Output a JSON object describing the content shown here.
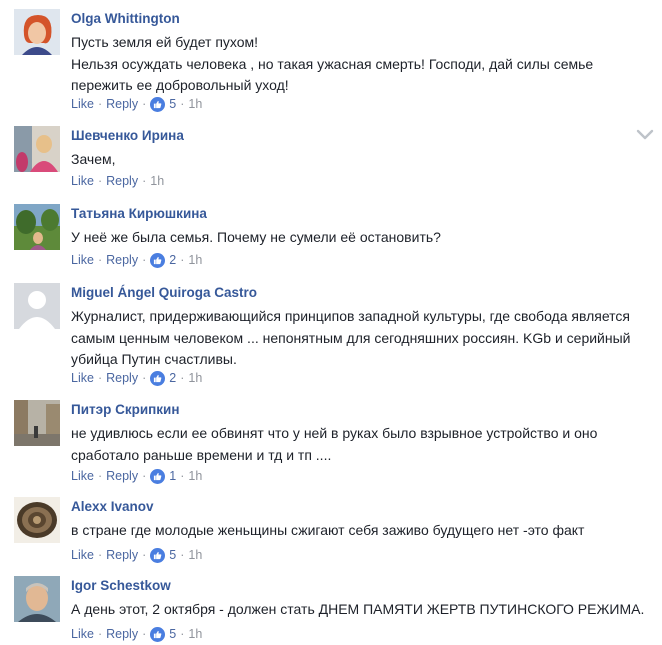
{
  "actions": {
    "like": "Like",
    "reply": "Reply",
    "separator": "·"
  },
  "comments": [
    {
      "author": "Olga Whittington",
      "lines": [
        "Пусть земля ей будет пухом!",
        "Нельзя осуждать человека , но такая ужасная смерть! Господи, дай силы семье",
        "пережить ее добровольный уход!"
      ],
      "reactions": "5",
      "time": "1h"
    },
    {
      "author": "Шевченко Ирина",
      "lines": [
        "Зачем,"
      ],
      "reactions": "",
      "time": "1h"
    },
    {
      "author": "Татьяна Кирюшкина",
      "lines": [
        "У неё же была семья. Почему не сумели её остановить?"
      ],
      "reactions": "2",
      "time": "1h"
    },
    {
      "author": "Miguel Ángel Quiroga Castro",
      "lines": [
        "Журналист, придерживающийся принципов западной культуры, где свобода является",
        "самым ценным человеком ... непонятным для сегодняшних россиян. KGb и серийный",
        "убийца Путин счастливы."
      ],
      "reactions": "2",
      "time": "1h"
    },
    {
      "author": "Питэр Скрипкин",
      "lines": [
        "не удивлюсь если ее обвинят что у ней в руках было взрывное устройство и оно",
        "сработало раньше времени и тд и тп ...."
      ],
      "reactions": "1",
      "time": "1h"
    },
    {
      "author": "Alexx Ivanov",
      "lines": [
        "в стране где молодые женьщины сжигают себя заживо будущего нет -это факт"
      ],
      "reactions": "5",
      "time": "1h"
    },
    {
      "author": "Igor Schestkow",
      "lines": [
        "А день этот, 2 октября - должен стать ДНЕМ ПАМЯТИ ЖЕРТВ ПУТИНСКОГО РЕЖИМА."
      ],
      "reactions": "5",
      "time": "1h"
    }
  ],
  "icons": {
    "reaction": "like-thumb-icon",
    "options": "chevron-down-icon"
  },
  "colors": {
    "author": "#365899",
    "meta": "#90949c",
    "link": "#4b67a1",
    "like_badge": "#4a7ee0"
  }
}
